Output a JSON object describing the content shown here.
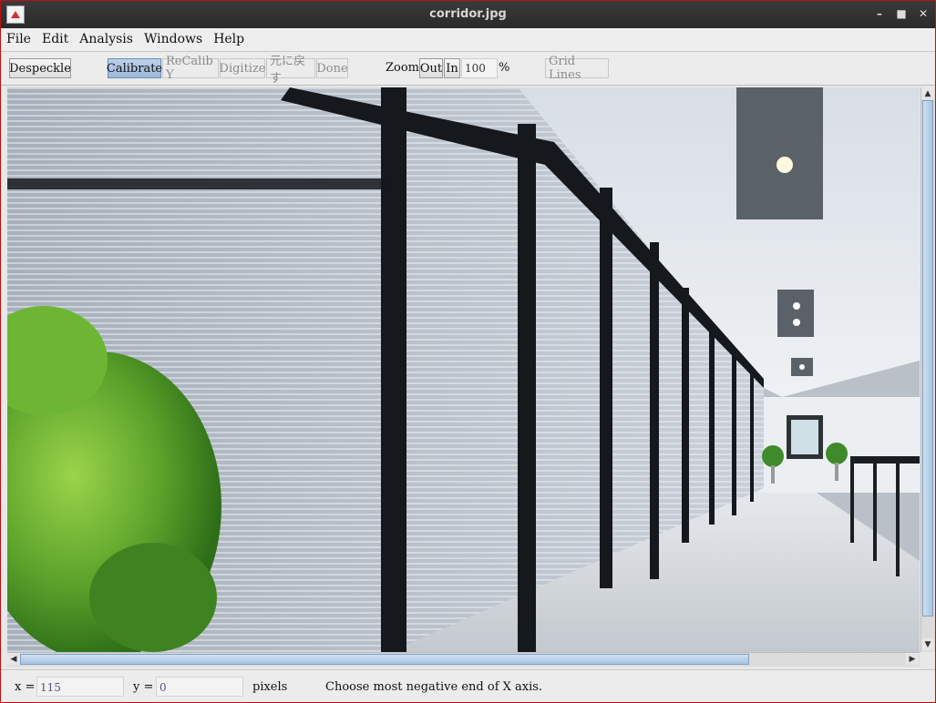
{
  "window": {
    "title": "corridor.jpg"
  },
  "menu": [
    "File",
    "Edit",
    "Analysis",
    "Windows",
    "Help"
  ],
  "toolbar": {
    "despeckle": "Despeckle",
    "calibrate": "Calibrate",
    "recalib_y": "ReCalib Y",
    "digitize": "Digitize",
    "undo": "元に戻す",
    "done": "Done",
    "zoom_label": "Zoom:",
    "zoom_out": "Out",
    "zoom_in": "In",
    "zoom_value": "100",
    "percent": "%",
    "grid_lines": "Grid Lines"
  },
  "canvas": {
    "image_name": "corridor.jpg",
    "image_description": "office corridor with glass walls and green plant"
  },
  "status": {
    "x_label": "x =",
    "x_value": "115",
    "y_label": "y =",
    "y_value": "0",
    "units": "pixels",
    "message": "Choose most negative end of X axis."
  },
  "colors": {
    "title_bar": "#2e2e2e",
    "active_button": "#a9c3e2",
    "window_border": "#bb1111"
  }
}
